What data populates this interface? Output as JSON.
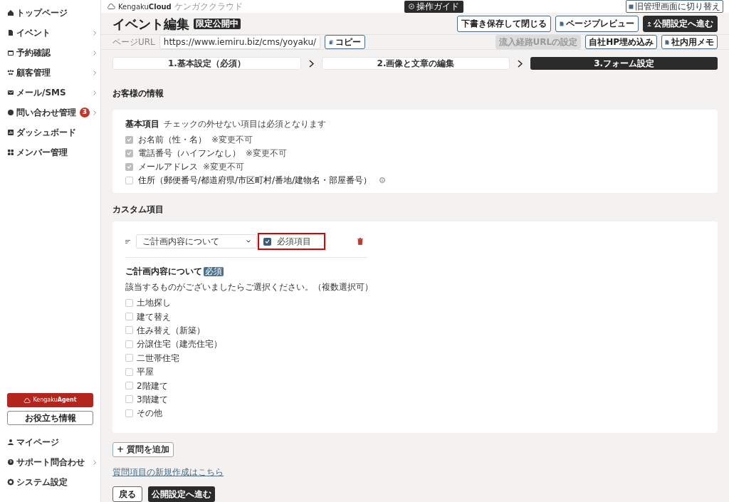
{
  "sidebar": {
    "items": [
      {
        "label": "トップページ",
        "chevron": false
      },
      {
        "label": "イベント",
        "chevron": true
      },
      {
        "label": "予約確認",
        "chevron": true
      },
      {
        "label": "顧客管理",
        "chevron": true
      },
      {
        "label": "メール/SMS",
        "chevron": true
      },
      {
        "label": "問い合わせ管理",
        "chevron": true,
        "badge": "3"
      },
      {
        "label": "ダッシュボード",
        "chevron": false
      },
      {
        "label": "メンバー管理",
        "chevron": false
      }
    ],
    "agent_button": {
      "brand_light": "Kengaku",
      "brand_bold": "Agent"
    },
    "info_button": "お役立ち情報",
    "bottom_items": [
      {
        "label": "マイページ",
        "chevron": false
      },
      {
        "label": "サポート問合わせ",
        "chevron": true
      },
      {
        "label": "システム設定",
        "chevron": false
      }
    ]
  },
  "topbar": {
    "logo_light": "Kengaku",
    "logo_bold": "Cloud",
    "tagline": "ケンガククラウド",
    "guide_button": "操作ガイド",
    "switch_button": "旧管理画面に切り替え"
  },
  "header": {
    "title": "イベント編集",
    "status_badge": "限定公開中",
    "buttons": [
      {
        "label": "下書き保存して閉じる",
        "kind": "outline"
      },
      {
        "label": "ページプレビュー",
        "kind": "preview"
      },
      {
        "label": "公開設定へ進む",
        "kind": "dark"
      }
    ]
  },
  "url_bar": {
    "label": "ページURL",
    "value": "https://www.iemiru.biz/cms/yoyaku/",
    "copy_button": "コピー",
    "buttons": [
      {
        "label": "流入経路URLの設定",
        "disabled": true,
        "icon": false
      },
      {
        "label": "自社HP埋め込み",
        "disabled": false,
        "icon": false
      },
      {
        "label": "社内用メモ",
        "disabled": false,
        "icon": true
      }
    ]
  },
  "steps": [
    {
      "label": "1.基本設定（必須）",
      "selected": false
    },
    {
      "label": "2.画像と文章の編集",
      "selected": false
    },
    {
      "label": "3.フォーム設定",
      "selected": true
    }
  ],
  "customer_section": {
    "title": "お客様の情報",
    "heading": "基本項目",
    "note": "チェックの外せない項目は必須となります",
    "fields": [
      {
        "label": "お名前（性・名）",
        "checked": true,
        "disabled": true,
        "note": "※変更不可",
        "info": false
      },
      {
        "label": "電話番号（ハイフンなし）",
        "checked": true,
        "disabled": true,
        "note": "※変更不可",
        "info": false
      },
      {
        "label": "メールアドレス",
        "checked": true,
        "disabled": true,
        "note": "※変更不可",
        "info": false
      },
      {
        "label": "住所（郵便番号/都道府県/市区町村/番地/建物名・部屋番号）",
        "checked": false,
        "disabled": false,
        "info": true
      }
    ]
  },
  "custom_section": {
    "title": "カスタム項目",
    "question": {
      "select_value": "ご計画内容について",
      "required_label": "必須項目",
      "required": true,
      "highlighted": true,
      "title": "ご計画内容について",
      "required_badge": "必須",
      "description": "該当するものがございましたらご選択ください。（複数選択可）",
      "options": [
        {
          "label": "土地探し",
          "checked": false
        },
        {
          "label": "建て替え",
          "checked": false
        },
        {
          "label": "住み替え（新築）",
          "checked": false
        },
        {
          "label": "分譲住宅（建売住宅）",
          "checked": false
        },
        {
          "label": "二世帯住宅",
          "checked": false
        },
        {
          "label": "平屋",
          "checked": false
        },
        {
          "label": "2階建て",
          "checked": false
        },
        {
          "label": "3階建て",
          "checked": false
        },
        {
          "label": "その他",
          "checked": false
        }
      ]
    }
  },
  "add_button": "+ 質問を追加",
  "new_question_link": "質問項目の新規作成はこちら",
  "footer_buttons": [
    {
      "label": "戻る",
      "kind": "outline"
    },
    {
      "label": "公開設定へ進む",
      "kind": "dark"
    }
  ]
}
